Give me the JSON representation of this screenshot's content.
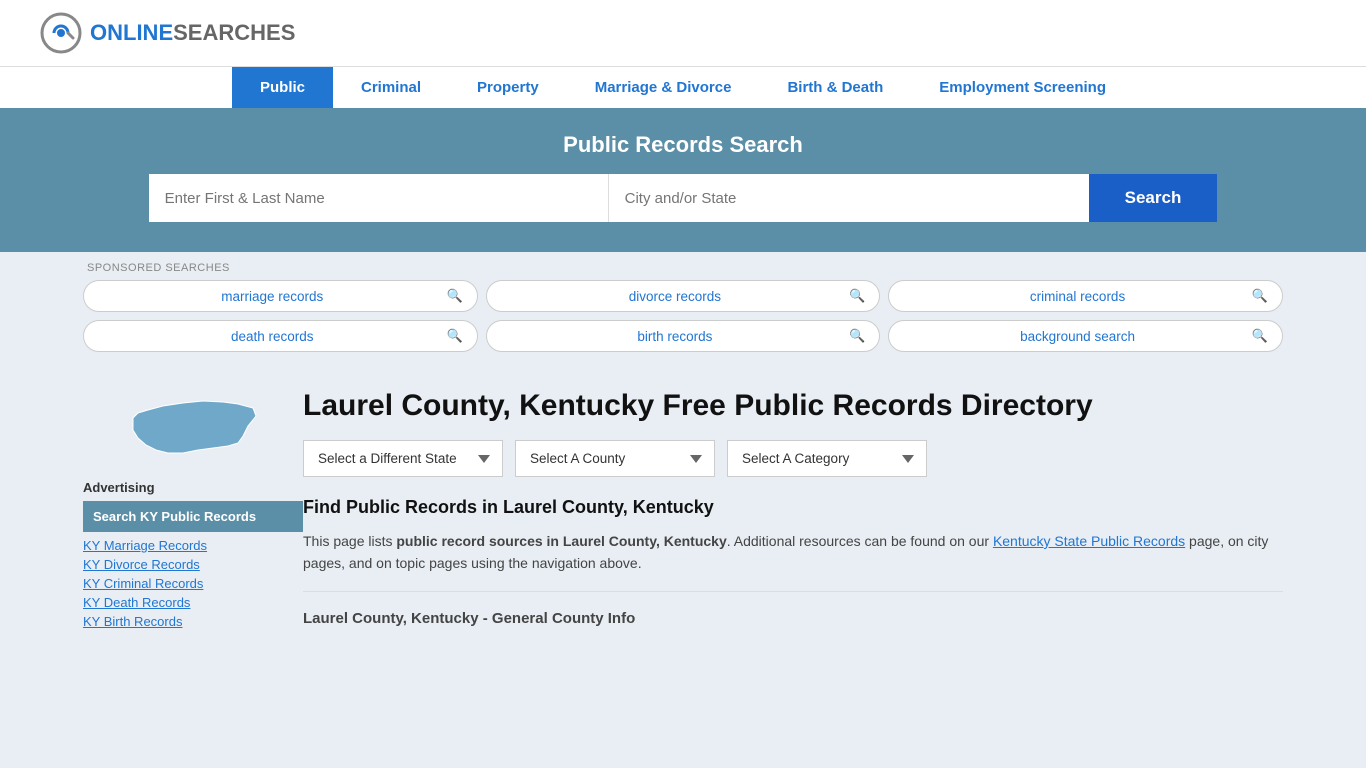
{
  "logo": {
    "text_online": "ONLINE",
    "text_searches": "SEARCHES"
  },
  "nav": {
    "items": [
      {
        "label": "Public",
        "active": true
      },
      {
        "label": "Criminal",
        "active": false
      },
      {
        "label": "Property",
        "active": false
      },
      {
        "label": "Marriage & Divorce",
        "active": false
      },
      {
        "label": "Birth & Death",
        "active": false
      },
      {
        "label": "Employment Screening",
        "active": false
      }
    ]
  },
  "search_banner": {
    "title": "Public Records Search",
    "name_placeholder": "Enter First & Last Name",
    "location_placeholder": "City and/or State",
    "button_label": "Search"
  },
  "sponsored": {
    "label": "SPONSORED SEARCHES",
    "tags": [
      {
        "text": "marriage records"
      },
      {
        "text": "divorce records"
      },
      {
        "text": "criminal records"
      },
      {
        "text": "death records"
      },
      {
        "text": "birth records"
      },
      {
        "text": "background search"
      }
    ]
  },
  "page": {
    "title": "Laurel County, Kentucky Free Public Records Directory",
    "dropdowns": {
      "state": "Select a Different State",
      "county": "Select A County",
      "category": "Select A Category"
    },
    "find_title": "Find Public Records in Laurel County, Kentucky",
    "find_desc_prefix": "This page lists ",
    "find_desc_bold": "public record sources in Laurel County, Kentucky",
    "find_desc_mid": ". Additional resources can be found on our ",
    "find_desc_link": "Kentucky State Public Records",
    "find_desc_suffix": " page, on city pages, and on topic pages using the navigation above.",
    "general_info_title": "Laurel County, Kentucky - General County Info"
  },
  "advertising": {
    "label": "Advertising",
    "active_item": "Search KY Public Records",
    "links": [
      "KY Marriage Records",
      "KY Divorce Records",
      "KY Criminal Records",
      "KY Death Records",
      "KY Birth Records"
    ]
  }
}
